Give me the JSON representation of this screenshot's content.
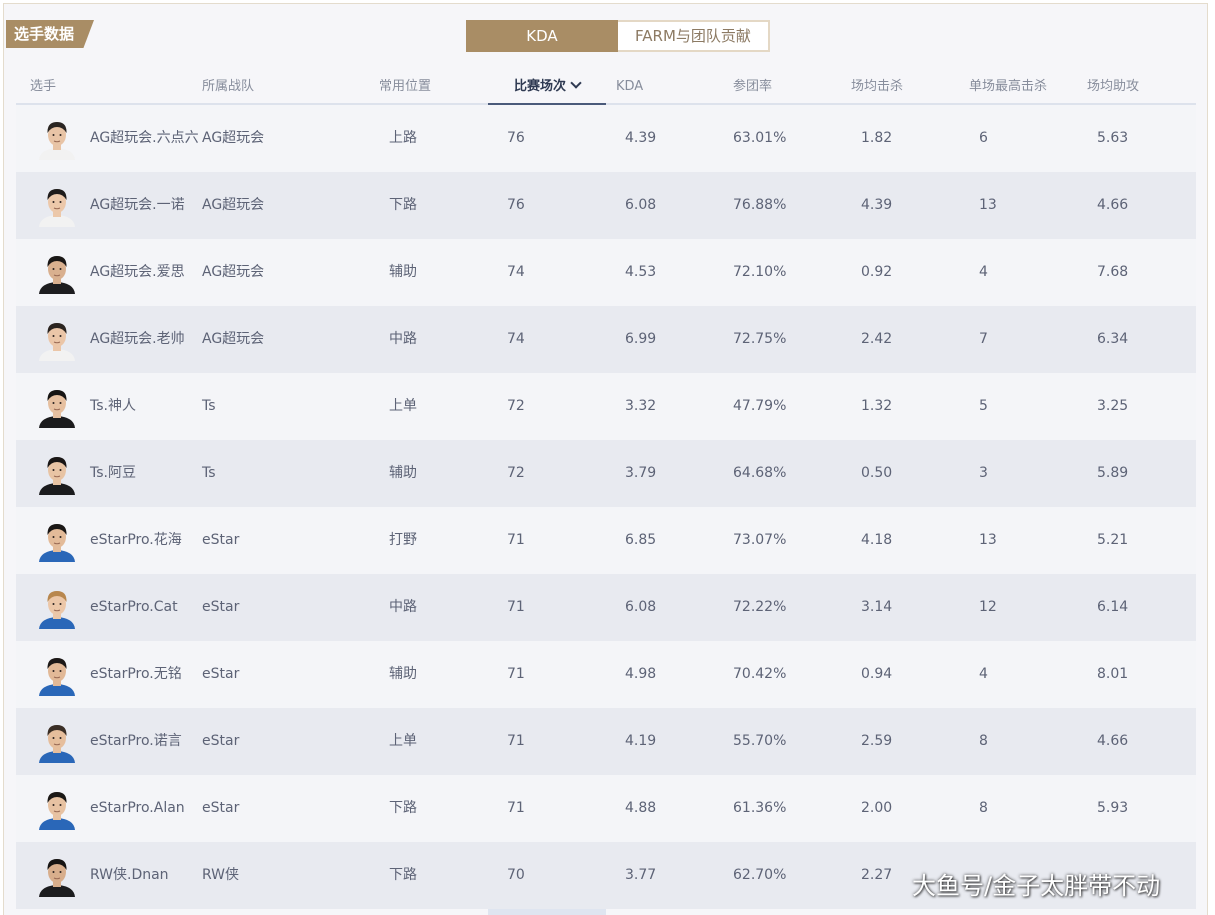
{
  "section_title": "选手数据",
  "tabs": [
    {
      "label": "KDA",
      "active": true
    },
    {
      "label": "FARM与团队贡献",
      "active": false
    }
  ],
  "columns": {
    "player": "选手",
    "team": "所属战队",
    "position": "常用位置",
    "matches": "比赛场次",
    "kda": "KDA",
    "participation": "参团率",
    "avg_kills": "场均击杀",
    "max_kills": "单场最高击杀",
    "avg_assists": "场均助攻"
  },
  "sorted_column": "matches",
  "colors": {
    "accent": "#a98d65",
    "highlight_column": "#dfe5f0",
    "row_even": "#f4f5f8",
    "row_odd": "#e8eaf0"
  },
  "rows": [
    {
      "player": "AG超玩会.六点六",
      "team": "AG超玩会",
      "position": "上路",
      "matches": "76",
      "kda": "4.39",
      "participation": "63.01%",
      "avg_kills": "1.82",
      "max_kills": "6",
      "avg_assists": "5.63",
      "jersey": "#f2f2f2",
      "skin": "#e8c4a6",
      "hair": "#2a2522"
    },
    {
      "player": "AG超玩会.一诺",
      "team": "AG超玩会",
      "position": "下路",
      "matches": "76",
      "kda": "6.08",
      "participation": "76.88%",
      "avg_kills": "4.39",
      "max_kills": "13",
      "avg_assists": "4.66",
      "jersey": "#f2f2f2",
      "skin": "#ecc8aa",
      "hair": "#1e1b1a"
    },
    {
      "player": "AG超玩会.爱思",
      "team": "AG超玩会",
      "position": "辅助",
      "matches": "74",
      "kda": "4.53",
      "participation": "72.10%",
      "avg_kills": "0.92",
      "max_kills": "4",
      "avg_assists": "7.68",
      "jersey": "#1d1d1f",
      "skin": "#d9b08f",
      "hair": "#1a1716"
    },
    {
      "player": "AG超玩会.老帅",
      "team": "AG超玩会",
      "position": "中路",
      "matches": "74",
      "kda": "6.99",
      "participation": "72.75%",
      "avg_kills": "2.42",
      "max_kills": "7",
      "avg_assists": "6.34",
      "jersey": "#f2f2f2",
      "skin": "#ebc6a8",
      "hair": "#2b2420"
    },
    {
      "player": "Ts.神人",
      "team": "Ts",
      "position": "上单",
      "matches": "72",
      "kda": "3.32",
      "participation": "47.79%",
      "avg_kills": "1.32",
      "max_kills": "5",
      "avg_assists": "3.25",
      "jersey": "#1b1b1d",
      "skin": "#e6c0a0",
      "hair": "#161413"
    },
    {
      "player": "Ts.阿豆",
      "team": "Ts",
      "position": "辅助",
      "matches": "72",
      "kda": "3.79",
      "participation": "64.68%",
      "avg_kills": "0.50",
      "max_kills": "3",
      "avg_assists": "5.89",
      "jersey": "#1b1b1d",
      "skin": "#e8c4a4",
      "hair": "#191615"
    },
    {
      "player": "eStarPro.花海",
      "team": "eStar",
      "position": "打野",
      "matches": "71",
      "kda": "6.85",
      "participation": "73.07%",
      "avg_kills": "4.18",
      "max_kills": "13",
      "avg_assists": "5.21",
      "jersey": "#2a67b8",
      "skin": "#e3bb99",
      "hair": "#1a1716"
    },
    {
      "player": "eStarPro.Cat",
      "team": "eStar",
      "position": "中路",
      "matches": "71",
      "kda": "6.08",
      "participation": "72.22%",
      "avg_kills": "3.14",
      "max_kills": "12",
      "avg_assists": "6.14",
      "jersey": "#2a67b8",
      "skin": "#ecc7a8",
      "hair": "#b8874e"
    },
    {
      "player": "eStarPro.无铭",
      "team": "eStar",
      "position": "辅助",
      "matches": "71",
      "kda": "4.98",
      "participation": "70.42%",
      "avg_kills": "0.94",
      "max_kills": "4",
      "avg_assists": "8.01",
      "jersey": "#2a67b8",
      "skin": "#e2b997",
      "hair": "#1c1817"
    },
    {
      "player": "eStarPro.诺言",
      "team": "eStar",
      "position": "上单",
      "matches": "71",
      "kda": "4.19",
      "participation": "55.70%",
      "avg_kills": "2.59",
      "max_kills": "8",
      "avg_assists": "4.66",
      "jersey": "#2a67b8",
      "skin": "#e6be9c",
      "hair": "#3a2e25"
    },
    {
      "player": "eStarPro.Alan",
      "team": "eStar",
      "position": "下路",
      "matches": "71",
      "kda": "4.88",
      "participation": "61.36%",
      "avg_kills": "2.00",
      "max_kills": "8",
      "avg_assists": "5.93",
      "jersey": "#2a67b8",
      "skin": "#e7c2a2",
      "hair": "#1b1816"
    },
    {
      "player": "RW侠.Dnan",
      "team": "RW侠",
      "position": "下路",
      "matches": "70",
      "kda": "3.77",
      "participation": "62.70%",
      "avg_kills": "2.27",
      "max_kills": "",
      "avg_assists": "",
      "jersey": "#1c1c1e",
      "skin": "#d8ae8c",
      "hair": "#161413"
    }
  ],
  "watermark": "大鱼号/金子太胖带不动"
}
